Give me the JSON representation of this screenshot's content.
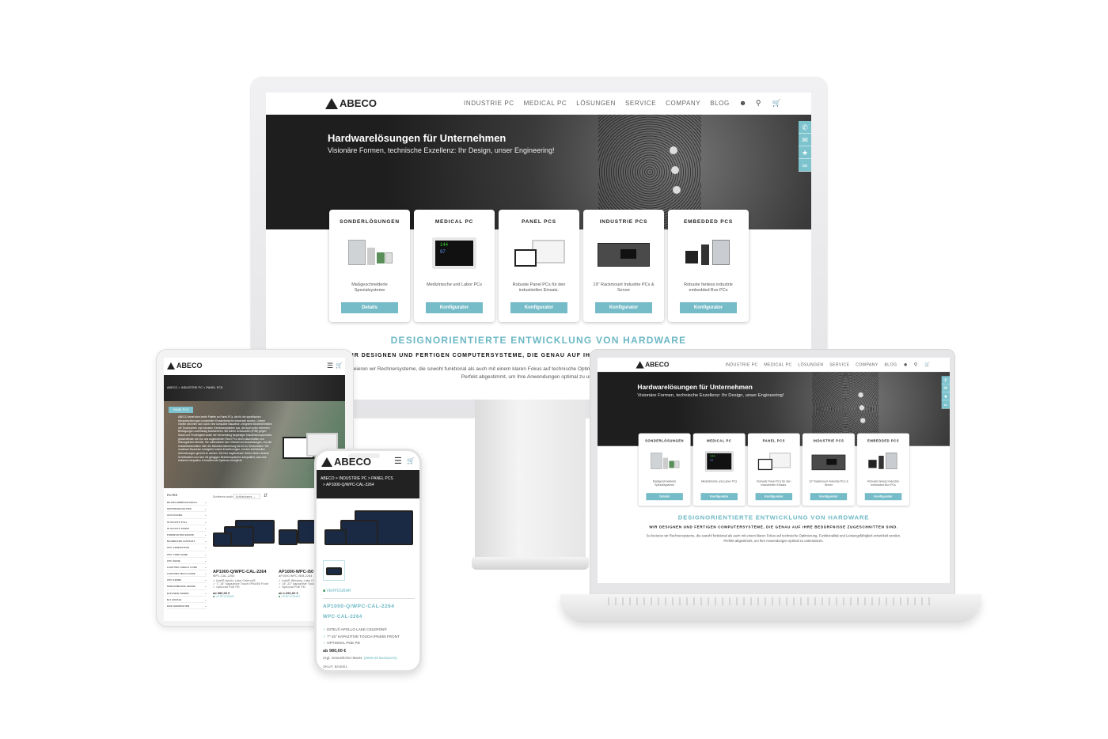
{
  "brand": {
    "logo": "ABECO",
    "accent": "#6cb8c4",
    "button": "#76bcc8"
  },
  "nav": {
    "items": [
      "INDUSTRIE PC",
      "MEDICAL PC",
      "LÖSUNGEN",
      "SERVICE",
      "COMPANY",
      "BLOG"
    ],
    "icons": [
      "user-icon",
      "search-icon",
      "cart-icon"
    ]
  },
  "hero": {
    "title": "Hardwarelösungen für Unternehmen",
    "subtitle": "Visionäre Formen, technische Exzellenz: Ihr Design, unser Engineering!"
  },
  "side_icons": [
    "phone-icon",
    "mail-icon",
    "certificate-icon",
    "link-icon"
  ],
  "cards": [
    {
      "title": "SONDERLÖSUNGEN",
      "desc": "Maßgeschneiderte Spezialsysteme",
      "button": "Details"
    },
    {
      "title": "MEDICAL PC",
      "desc": "Medizinische und Labor PCs",
      "button": "Konfigurator"
    },
    {
      "title": "PANEL PCS",
      "desc": "Robuste Panel PCs für den industriellen Einsatz.",
      "button": "Konfigurator"
    },
    {
      "title": "INDUSTRIE PCS",
      "desc": "19\" Rackmount Industrie PCs & Server",
      "button": "Konfigurator"
    },
    {
      "title": "EMBEDDED PCS",
      "desc": "Robuste fanless industrie embedded Box PCs",
      "button": "Konfigurator"
    }
  ],
  "section": {
    "heading": "DESIGNORIENTIERTE ENTWICKLUNG VON HARDWARE",
    "subheading": "WIR DESIGNEN UND FERTIGEN COMPUTERSYSTEME, DIE GENAU AUF IHRE BEDÜRFNISSE ZUGESCHNITTEN SIND.",
    "para1": "So kreieren wir Rechnersysteme, die sowohl funktional als auch mit einem klaren Fokus auf technische Optimierung, Funktionalität und Leistungsfähigkeit entwickelt werden.",
    "para2": "Perfekt abgestimmt, um Ihre Anwendungen optimal zu unterstützen."
  },
  "tablet": {
    "breadcrumb": "ABECO  >  INDUSTRIE PC  >  PANEL PCS",
    "badge": "PANEL PCS",
    "intro": "ABECO bietet eine breite Palette an Panel-PCs, die für die spezifischen Herausforderungen industrieller Einsatzbereiche entwickelt wurden. Unsere Geräte zeichnen sich durch eine kompakte Bauweise, integrierte Bedieneinheiten mit Touchscreen und robusten Gehäusevarianten aus, die auch unter extremen Bedingungen zuverlässig funktionieren. Mit hohen Schutzarten (IP65) gegen Staub und Feuchtigkeit sowie der Verwendung langlebiger Industriekomponenten gewährleisten die von uns angebotenen Panel PCs einen dauerhaften und störungsfreien Betrieb. Sie unterstützen eine Vielzahl von Anwendungen, von der Industrieautomation über die Maschinensteuerung bis hin zu Sensordaten. Die modulare Bauweise ermöglicht zudem Erweiterungen, um den individuellen Anforderungen gerecht zu werden. Die hier angebotenen Serien bieten diverse Schnittstellen und sind mit gängigen Betriebssystemen kompatibel, was eine einfache Integration in bestehende Systeme ermöglicht.",
    "filter_title": "FILTER",
    "filters": [
      "BILDSCHIRMDIAGONALE",
      "SEITENVERHÄLTNIS",
      "AUFLÖSUNG",
      "IP-SCHUTZ FULL",
      "IP-SCHUTZ FRONT",
      "FORMFAKTOR BOARD",
      "MAINBOARD CHIPSATZ",
      "CPU GENERATION",
      "CPU CODE NAME",
      "CPU SERIE",
      "LEISTUNG SINGLE CORE",
      "LEISTUNG MULTI CORE",
      "CPU KERNE",
      "PERFORMANCE KERNE",
      "EFFIZIENZ KERNE",
      "M.2 ANZAHL",
      "RAM GENERATION"
    ],
    "sort_label": "Sortieren nach",
    "sort_value": "Artikelname",
    "products": [
      {
        "name": "AP1000-Q/WPC-CAL-2264",
        "sku": "WPC-CAL-2264",
        "features": [
          "Intel® Apollo Lake Celeron®",
          "7\"-15\" kapazitive Touch IP64/65 Front",
          "Optional PoE PD"
        ],
        "price": "ab 980,00 €",
        "status": "VERFÜGBAR"
      },
      {
        "name": "AP1000-WPC-i50",
        "sku": "AP1000-WPC-i508-2264",
        "features": [
          "Intel® Whiskey Lake Co",
          "15\"-22\" kapazitive Touc",
          "Optional PoE PD"
        ],
        "price": "ab 1.991,00 €",
        "status": "VERFÜGBAR"
      }
    ]
  },
  "phone": {
    "breadcrumb1": "ABECO   >  INDUSTRIE PC  >  PANEL PCS",
    "breadcrumb2": ">  AP1000-Q/WPC-CAL-2264",
    "status": "VERFÜGBAR",
    "name": "AP1000-Q/WPC-CAL-2264",
    "sku": "WPC-CAL-2264",
    "features": [
      "INTEL® APOLLO LAKE CELERON®",
      "7\"-15\" KAPAZITIVE TOUCH IP64/65 FRONT",
      "OPTIONAL POE PD"
    ],
    "price": "ab 980,00 €",
    "tax": "zzgl. Gesetzlicher MwSt.",
    "base_price": "(€980,00 Basispreis)",
    "sku_label": "SKU#:",
    "sku_value": "BA0001"
  }
}
